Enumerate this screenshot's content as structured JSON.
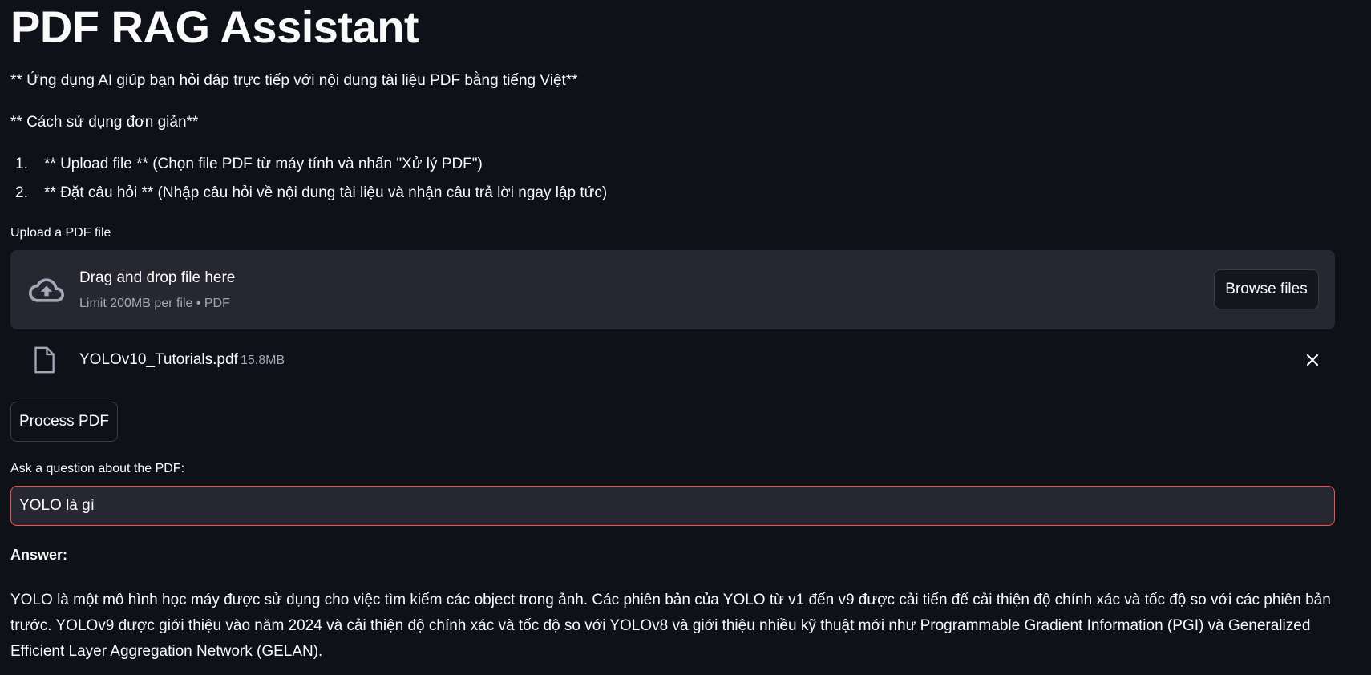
{
  "header": {
    "title": "PDF RAG Assistant"
  },
  "intro": {
    "line1": "** Ứng dụng AI giúp bạn hỏi đáp trực tiếp với nội dung tài liệu PDF bằng tiếng Việt**",
    "line2": "** Cách sử dụng đơn giản**",
    "steps": [
      {
        "num": "1.",
        "text": "** Upload file ** (Chọn file PDF từ máy tính và nhấn \"Xử lý PDF\")"
      },
      {
        "num": "2.",
        "text": "** Đặt câu hỏi ** (Nhập câu hỏi về nội dung tài liệu và nhận câu trả lời ngay lập tức)"
      }
    ]
  },
  "uploader": {
    "label": "Upload a PDF file",
    "drop_title": "Drag and drop file here",
    "drop_subtitle": "Limit 200MB per file • PDF",
    "browse_label": "Browse files",
    "icon": "cloud-upload-icon",
    "file": {
      "name": "YOLOv10_Tutorials.pdf",
      "size": "15.8MB",
      "icon": "file-icon"
    }
  },
  "actions": {
    "process_label": "Process PDF"
  },
  "question": {
    "label": "Ask a question about the PDF:",
    "value": "YOLO là gì"
  },
  "answer": {
    "title": "Answer:",
    "text": "YOLO là một mô hình học máy được sử dụng cho việc tìm kiếm các object trong ảnh. Các phiên bản của YOLO từ v1 đến v9 được cải tiến để cải thiện độ chính xác và tốc độ so với các phiên bản trước. YOLOv9 được giới thiệu vào năm 2024 và cải thiện độ chính xác và tốc độ so với YOLOv8 và giới thiệu nhiều kỹ thuật mới như Programmable Gradient Information (PGI) và Generalized Efficient Layer Aggregation Network (GELAN)."
  },
  "colors": {
    "background": "#0e1117",
    "surface": "#262730",
    "text": "#fafafa",
    "muted": "#a3a8b8",
    "focus_border": "#ff4b4b"
  }
}
